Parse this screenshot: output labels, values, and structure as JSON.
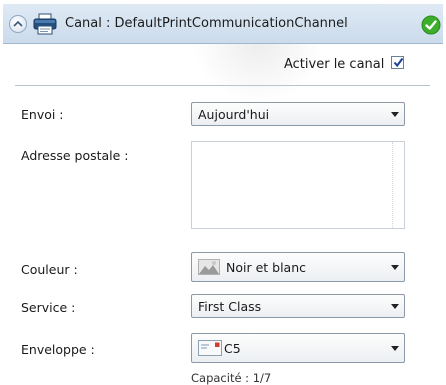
{
  "header": {
    "title": "Canal : DefaultPrintCommunicationChannel"
  },
  "activate": {
    "label": "Activer le canal",
    "checked": true
  },
  "fields": {
    "envoi": {
      "label": "Envoi :",
      "value": "Aujourd'hui"
    },
    "adresse": {
      "label": "Adresse postale :",
      "value": ""
    },
    "couleur": {
      "label": "Couleur :",
      "value": "Noir et blanc"
    },
    "service": {
      "label": "Service :",
      "value": "First Class"
    },
    "enveloppe": {
      "label": "Enveloppe :",
      "value": "C5"
    }
  },
  "capacity": "Capacité : 1/7",
  "colors": {
    "header_bg": "#d6e3f0",
    "ok_green": "#3cae2c",
    "checkbox_mark": "#1f3f9c"
  }
}
